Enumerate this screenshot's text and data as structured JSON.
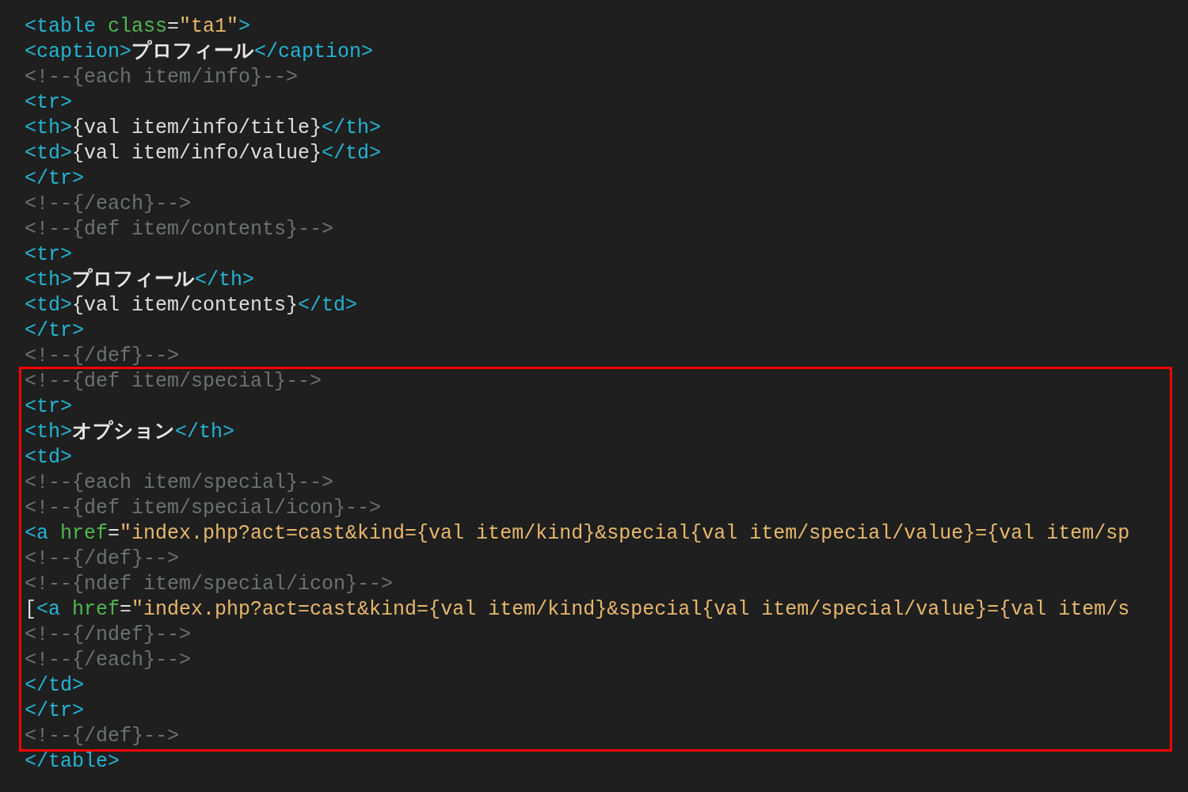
{
  "before": [
    [
      {
        "kind": "tag",
        "text": "<table "
      },
      {
        "kind": "attr",
        "text": "class"
      },
      {
        "kind": "text",
        "text": "="
      },
      {
        "kind": "string",
        "text": "\"ta1\""
      },
      {
        "kind": "tag",
        "text": ">"
      }
    ],
    [
      {
        "kind": "tag",
        "text": "<caption>"
      },
      {
        "kind": "strong",
        "text": "プロフィール"
      },
      {
        "kind": "tag",
        "text": "</caption>"
      }
    ],
    [
      {
        "kind": "comment",
        "text": "<!--{each item/info}-->"
      }
    ],
    [
      {
        "kind": "tag",
        "text": "<tr>"
      }
    ],
    [
      {
        "kind": "tag",
        "text": "<th>"
      },
      {
        "kind": "text",
        "text": "{val item/info/title}"
      },
      {
        "kind": "tag",
        "text": "</th>"
      }
    ],
    [
      {
        "kind": "tag",
        "text": "<td>"
      },
      {
        "kind": "text",
        "text": "{val item/info/value}"
      },
      {
        "kind": "tag",
        "text": "</td>"
      }
    ],
    [
      {
        "kind": "tag",
        "text": "</tr>"
      }
    ],
    [
      {
        "kind": "comment",
        "text": "<!--{/each}-->"
      }
    ],
    [
      {
        "kind": "comment",
        "text": "<!--{def item/contents}-->"
      }
    ],
    [
      {
        "kind": "tag",
        "text": "<tr>"
      }
    ],
    [
      {
        "kind": "tag",
        "text": "<th>"
      },
      {
        "kind": "strong",
        "text": "プロフィール"
      },
      {
        "kind": "tag",
        "text": "</th>"
      }
    ],
    [
      {
        "kind": "tag",
        "text": "<td>"
      },
      {
        "kind": "text",
        "text": "{val item/contents}"
      },
      {
        "kind": "tag",
        "text": "</td>"
      }
    ],
    [
      {
        "kind": "tag",
        "text": "</tr>"
      }
    ],
    [
      {
        "kind": "comment",
        "text": "<!--{/def}-->"
      }
    ]
  ],
  "highlighted": [
    [
      {
        "kind": "comment",
        "text": "<!--{def item/special}-->"
      }
    ],
    [
      {
        "kind": "tag",
        "text": "<tr>"
      }
    ],
    [
      {
        "kind": "tag",
        "text": "<th>"
      },
      {
        "kind": "strong",
        "text": "オプション"
      },
      {
        "kind": "tag",
        "text": "</th>"
      }
    ],
    [
      {
        "kind": "tag",
        "text": "<td>"
      }
    ],
    [
      {
        "kind": "comment",
        "text": "<!--{each item/special}-->"
      }
    ],
    [
      {
        "kind": "comment",
        "text": "<!--{def item/special/icon}-->"
      }
    ],
    [
      {
        "kind": "tag",
        "text": "<a "
      },
      {
        "kind": "attr",
        "text": "href"
      },
      {
        "kind": "text",
        "text": "="
      },
      {
        "kind": "string",
        "text": "\"index.php?act=cast&kind={val item/kind}&special{val item/special/value}={val item/sp"
      }
    ],
    [
      {
        "kind": "comment",
        "text": "<!--{/def}-->"
      }
    ],
    [
      {
        "kind": "comment",
        "text": "<!--{ndef item/special/icon}-->"
      }
    ],
    [
      {
        "kind": "text",
        "text": "["
      },
      {
        "kind": "tag",
        "text": "<a "
      },
      {
        "kind": "attr",
        "text": "href"
      },
      {
        "kind": "text",
        "text": "="
      },
      {
        "kind": "string",
        "text": "\"index.php?act=cast&kind={val item/kind}&special{val item/special/value}={val item/s"
      }
    ],
    [
      {
        "kind": "comment",
        "text": "<!--{/ndef}-->"
      }
    ],
    [
      {
        "kind": "comment",
        "text": "<!--{/each}-->"
      }
    ],
    [
      {
        "kind": "tag",
        "text": "</td>"
      }
    ],
    [
      {
        "kind": "tag",
        "text": "</tr>"
      }
    ],
    [
      {
        "kind": "comment",
        "text": "<!--{/def}-->"
      }
    ]
  ],
  "after": [
    [
      {
        "kind": "tag",
        "text": "</table>"
      }
    ]
  ]
}
